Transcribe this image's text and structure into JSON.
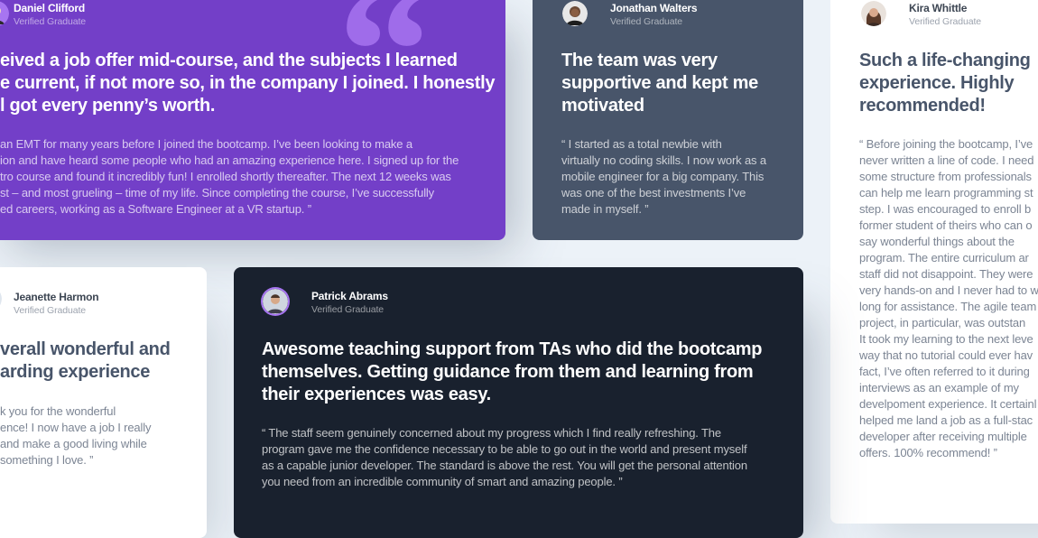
{
  "testimonials": {
    "daniel": {
      "name": "Daniel Clifford",
      "role": "Verified Graduate",
      "headline_lines": [
        "eived a job offer mid-course, and the subjects I learned",
        "e current, if not more so, in the company I joined. I honestly",
        "l got every penny’s worth."
      ],
      "body_lines": [
        "an EMT for many years before I joined the bootcamp. I’ve been looking to make a",
        "ion and have heard some people who had an amazing experience here. I signed up for the",
        "tro course and found it incredibly fun! I enrolled shortly thereafter. The next 12 weeks was",
        "st – and most grueling – time of my life. Since completing the course, I’ve successfully",
        "ed careers, working as a Software Engineer at a VR startup. ”"
      ],
      "bg": "#733fc8"
    },
    "jonathan": {
      "name": "Jonathan Walters",
      "role": "Verified Graduate",
      "headline_lines": [
        "The team was very",
        "supportive and kept me",
        "motivated"
      ],
      "body_lines": [
        "“ I started as a total newbie with",
        "virtually no coding skills. I now work as a",
        "mobile engineer for a big company. This",
        "was one of the best investments I’ve",
        "made in myself. ”"
      ],
      "bg": "#48556a"
    },
    "kira": {
      "name": "Kira Whittle",
      "role": "Verified Graduate",
      "headline_lines": [
        "Such a life-changing",
        "experience. Highly",
        "recommended!"
      ],
      "body_lines": [
        "“ Before joining the bootcamp, I’ve",
        "never written a line of code. I need",
        "some structure from professionals",
        "can help me learn programming st",
        "step. I was encouraged to enroll b",
        "former student of theirs who can o",
        "say wonderful things about the",
        "program. The entire curriculum ar",
        "staff did not disappoint. They were",
        "very hands-on and I never had to w",
        "long for assistance. The agile team",
        "project, in particular, was outstan",
        "It took my learning to the next leve",
        "way that no tutorial could ever hav",
        "fact, I’ve often referred to it during",
        "interviews as an example of my",
        "develpoment experience. It certainl",
        "helped me land a job as a full-stac",
        "developer after receiving multiple",
        "offers. 100% recommend! ”"
      ],
      "bg": "#ffffff"
    },
    "jeanette": {
      "name": "Jeanette Harmon",
      "role": "Verified Graduate",
      "headline_lines": [
        "verall wonderful and",
        "arding experience"
      ],
      "body_lines": [
        "k you for the wonderful",
        "ence! I now have a job I really",
        "and make a good living while",
        "something I love. ”"
      ],
      "bg": "#ffffff"
    },
    "patrick": {
      "name": "Patrick Abrams",
      "role": "Verified Graduate",
      "headline_lines": [
        "Awesome teaching support from TAs who did the bootcamp",
        "themselves. Getting guidance from them and learning from",
        "their experiences was easy."
      ],
      "body_lines": [
        "“ The staff seem genuinely concerned about my progress which I find really refreshing. The",
        "program gave me the confidence necessary to be able to go out in the world and present myself",
        "as a capable junior developer. The standard is above the rest. You will get the personal attention",
        "you need from an incredible community of smart and amazing people. ”"
      ],
      "bg": "#19212e"
    }
  },
  "decor": {
    "quote_glyph": "“",
    "quote_icon": "quotation-mark-icon"
  },
  "colors": {
    "page_bg": "#ecf2f8",
    "moderate_violet": "#733fc8",
    "grayish_blue": "#48556a",
    "blackish_blue": "#19212e",
    "accent_violet": "#a775f1"
  }
}
